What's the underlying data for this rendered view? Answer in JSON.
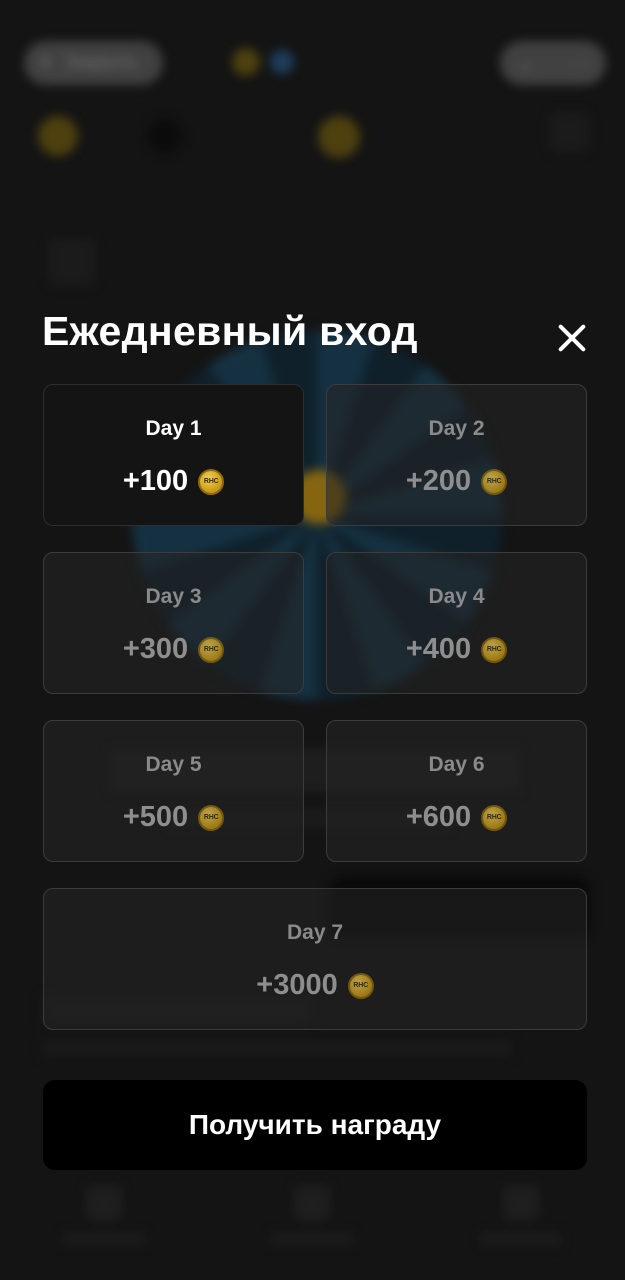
{
  "background": {
    "close_label": "Закрыть"
  },
  "modal": {
    "title": "Ежедневный вход",
    "coin_label": "RHC",
    "days": [
      {
        "label": "Day 1",
        "reward": "+100",
        "active": true
      },
      {
        "label": "Day 2",
        "reward": "+200",
        "active": false
      },
      {
        "label": "Day 3",
        "reward": "+300",
        "active": false
      },
      {
        "label": "Day 4",
        "reward": "+400",
        "active": false
      },
      {
        "label": "Day 5",
        "reward": "+500",
        "active": false
      },
      {
        "label": "Day 6",
        "reward": "+600",
        "active": false
      },
      {
        "label": "Day 7",
        "reward": "+3000",
        "active": false
      }
    ],
    "claim_label": "Получить награду"
  },
  "colors": {
    "coin": "#d9a816",
    "active_card": "#141414",
    "button": "#000000"
  }
}
